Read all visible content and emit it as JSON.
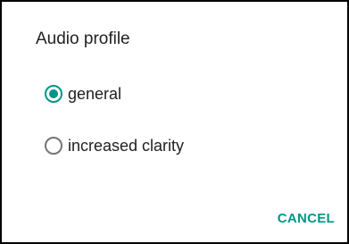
{
  "dialog": {
    "title": "Audio profile",
    "options": [
      {
        "label": "general",
        "selected": true
      },
      {
        "label": "increased clarity",
        "selected": false
      }
    ],
    "cancel_label": "CANCEL"
  },
  "colors": {
    "accent": "#009688",
    "text": "#212121",
    "radio_unchecked": "#757575"
  }
}
